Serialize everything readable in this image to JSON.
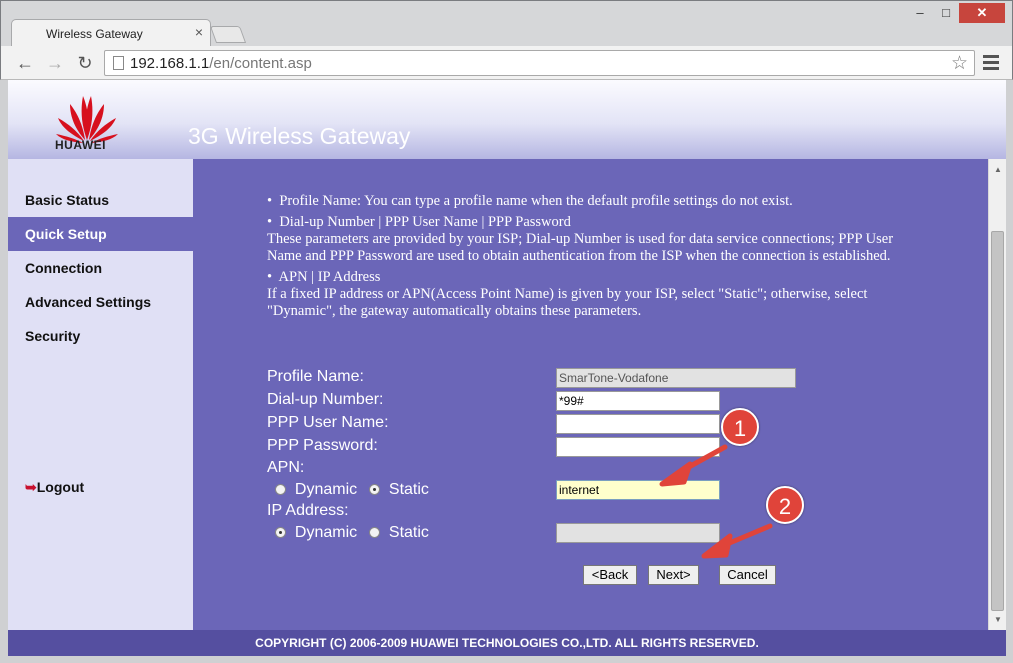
{
  "browser": {
    "tab_title": "Wireless Gateway",
    "url_host": "192.168.1.1",
    "url_path": "/en/content.asp",
    "window_min": "‒",
    "window_max": "□",
    "window_close": "✕"
  },
  "header": {
    "brand": "HUAWEI",
    "app_title": "3G Wireless Gateway"
  },
  "sidebar": {
    "items": [
      {
        "label": "Basic Status",
        "active": false
      },
      {
        "label": "Quick Setup",
        "active": true
      },
      {
        "label": "Connection",
        "active": false
      },
      {
        "label": "Advanced Settings",
        "active": false
      },
      {
        "label": "Security",
        "active": false
      }
    ],
    "logout": "Logout"
  },
  "help": {
    "profile_title": "Profile Name: You can type a profile name when the default profile settings do not exist.",
    "dialup_title": "Dial-up Number | PPP User Name | PPP Password",
    "dialup_text": "These parameters are provided by your ISP; Dial-up Number is used for data service connections; PPP User Name and PPP Password are used to obtain authentication from the ISP when the connection is established.",
    "apn_title": "APN | IP Address",
    "apn_text": "If a fixed IP address or APN(Access Point Name) is given by your ISP, select \"Static\"; otherwise, select \"Dynamic\", the gateway automatically obtains these parameters."
  },
  "form": {
    "profile_name_label": "Profile Name:",
    "profile_name_value": "SmarTone-Vodafone",
    "dialup_label": "Dial-up Number:",
    "dialup_value": "*99#",
    "ppp_user_label": "PPP User Name:",
    "ppp_user_value": "",
    "ppp_password_label": "PPP Password:",
    "ppp_password_value": "",
    "apn_label": "APN:",
    "apn_dynamic": "Dynamic",
    "apn_static": "Static",
    "apn_selected": "Static",
    "apn_value": "internet",
    "ip_label": "IP Address:",
    "ip_dynamic": "Dynamic",
    "ip_static": "Static",
    "ip_selected": "Dynamic",
    "ip_value": ""
  },
  "buttons": {
    "back": "<Back",
    "next": "Next>",
    "cancel": "Cancel"
  },
  "footer": "COPYRIGHT (C) 2006-2009 HUAWEI TECHNOLOGIES CO.,LTD. ALL RIGHTS RESERVED.",
  "annotations": {
    "step1": "1",
    "step2": "2",
    "color": "#e0443a"
  }
}
